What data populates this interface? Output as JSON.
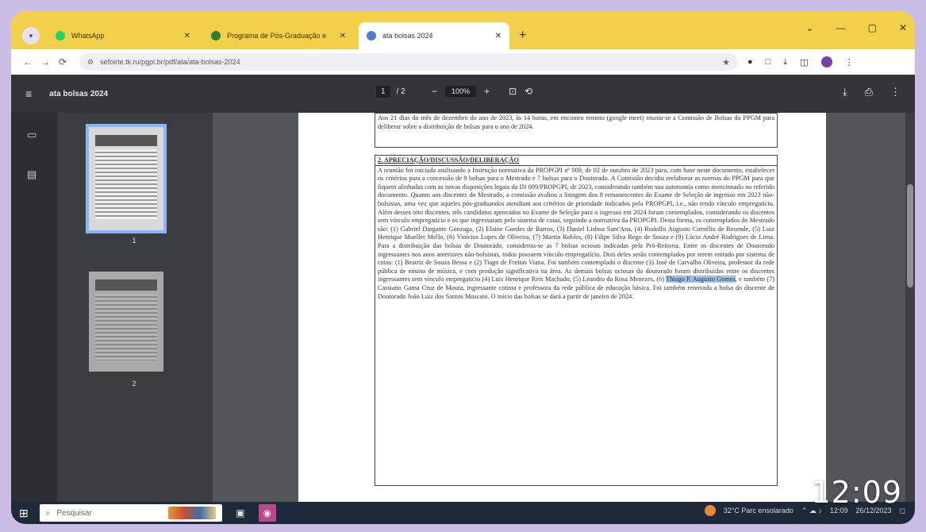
{
  "browser": {
    "tab_menu": "▾",
    "tabs": [
      {
        "label": "WhatsApp",
        "favicon_color": "#25d366",
        "active": false
      },
      {
        "label": "Programa de Pós-Graduação e",
        "favicon_color": "#2e7d32",
        "active": false
      },
      {
        "label": "ata bolsas 2024",
        "favicon_color": "#4a7fd4",
        "active": true
      }
    ],
    "new_tab": "+",
    "window_controls": [
      "⌄",
      "—",
      "▢",
      "✕"
    ],
    "nav": {
      "back": "←",
      "forward": "→",
      "reload": "⟳"
    },
    "address": "sefoirte.tk.ru/pgpi.br/pdf/ata/ata-bolsas-2024",
    "toolbar_icons": [
      "★",
      "●",
      "□",
      "⤓",
      "◫"
    ]
  },
  "pdf": {
    "menu_icon": "≡",
    "title": "ata bolsas 2024",
    "page_current": "1",
    "page_total": "/ 2",
    "zoom_out": "−",
    "zoom": "100%",
    "zoom_in": "+",
    "right_icons": [
      "⤓",
      "⎙",
      "⋮"
    ],
    "thumbnails": [
      {
        "label": "1"
      },
      {
        "label": "2"
      }
    ]
  },
  "document": {
    "intro_lines": "Aos 21 dias do mês de dezembro do ano de 2023, às 14 horas, em encontro remoto (google meet) reuniu-se a Comissão de Bolsas do PPGM para deliberar sobre a distribuição de bolsas para o ano de 2024.",
    "section_title": "2. APRECIAÇÃO/DISCUSSÃO/DELIBERAÇÃO",
    "body_before": "A reunião foi iniciada analisando a Instrução normativa da PROPGPI nº 009, de 02 de outubro de 2023 para, com base neste documento, estabelecer os critérios para a concessão de 9 bolsas para o Mestrado e 7 bolsas para o Doutorado. A Comissão decidiu reelaborar as normas do PPGM para que fiquem alinhadas com as novas disposições legais da IN 009/PROPGPI, de 2023, considerando também sua autonomia como mencionado no referido documento. Quanto aos discentes do Mestrado, a comissão avaliou a listagem dos 8 remanescentes do Exame de Seleção de ingresso em 2023 não-bolsistas, uma vez que aqueles pós-graduandos atendiam aos critérios de prioridade indicados pela PROPGPI, i.e., não tendo vínculo empregatício. Além desses oito discentes, três candidatos aprovados no Exame de Seleção para o ingresso em 2024 foram contemplados, considerando os discentes sem vínculo empregatício e os que ingressaram pelo sistema de cotas, seguindo a normativa da PROPGPI. Desta forma, os contemplados do Mestrado são: (1) Gabriel Dargante Gonzaga, (2) Elaine Guedes de Barros, (3) Daniel Lisboa Sant'Ana, (4) Rodolfo Augusto Cornélio de Resende, (5) Luiz Henrique Mueller Mello, (6) Vinícius Lopes de Oliveira, (7) Martin Robles, (8) Filipe Silva Rego de Souza e (9) Lúcio André Rodrigues de Lima. Para a distribuição das bolsas de Doutorado, considerou-se as 7 bolsas ociosas indicadas pela Pró-Reitoria. Entre os discentes de Doutorado ingressantes nos anos anteriores não-bolsistas, todos possuem vínculo empregatício. Dois deles serão contemplados por terem entrado por sistema de cotas: (1) Beatriz de Souza Bessa e (2) Tiago de Freitas Viana. Foi também contemplado o discente (3) José de Carvalho Oliveira, professor da rede pública de ensino de música, e com produção significativa na área. As demais bolsas ociosas do doutorado foram distribuídas entre os discentes ingressantes sem vínculo empregatício (4) Luis Henrique Reis Machado, (5) Leandro da Rosa Menezes, (6) ",
    "highlight": "Thiago P. Augusto Gomes",
    "body_after": ", e também (7) Cassiano Gama Cruz de Moura, ingressante cotista e professora da rede pública de educação básica. Foi também renovada a bolsa do discente de Doutorado João Luiz dos Santos Moscato. O início das bolsas se dará a partir de janeiro de 2024."
  },
  "taskbar": {
    "start_icon": "⊞",
    "search_placeholder": "Pesquisar",
    "search_icon": "⌕",
    "apps": [
      "▣",
      "◉"
    ],
    "weather": "32°C  Parc ensolarado",
    "tray_icons": "⌃  ☁  ♪",
    "clock": "12:09",
    "date": "26/12/2023"
  },
  "overlay": {
    "time": "12:09"
  }
}
